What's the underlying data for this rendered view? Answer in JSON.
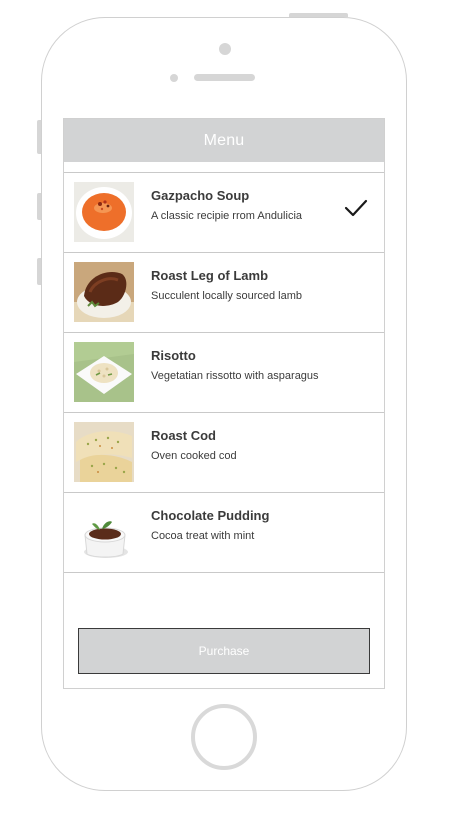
{
  "device": {
    "type": "iphone-wireframe"
  },
  "nav": {
    "title": "Menu"
  },
  "menu_items": [
    {
      "title": "Gazpacho Soup",
      "subtitle": "A classic recipie rrom Andulicia",
      "selected": true,
      "thumb_icon": "soup-bowl"
    },
    {
      "title": "Roast Leg of Lamb",
      "subtitle": "Succulent locally sourced lamb",
      "selected": false,
      "thumb_icon": "roast-meat"
    },
    {
      "title": "Risotto",
      "subtitle": "Vegetatian rissotto with asparagus",
      "selected": false,
      "thumb_icon": "rice-plate"
    },
    {
      "title": "Roast Cod",
      "subtitle": "Oven cooked cod",
      "selected": false,
      "thumb_icon": "fish-fillet"
    },
    {
      "title": "Chocolate Pudding",
      "subtitle": "Cocoa treat with mint",
      "selected": false,
      "thumb_icon": "pudding-ramekin"
    }
  ],
  "purchase": {
    "label": "Purchase"
  },
  "colors": {
    "nav_bar": "#d2d3d4",
    "button": "#d2d3d4",
    "text": "#3b3b3b",
    "outline": "#d0d0d0"
  }
}
